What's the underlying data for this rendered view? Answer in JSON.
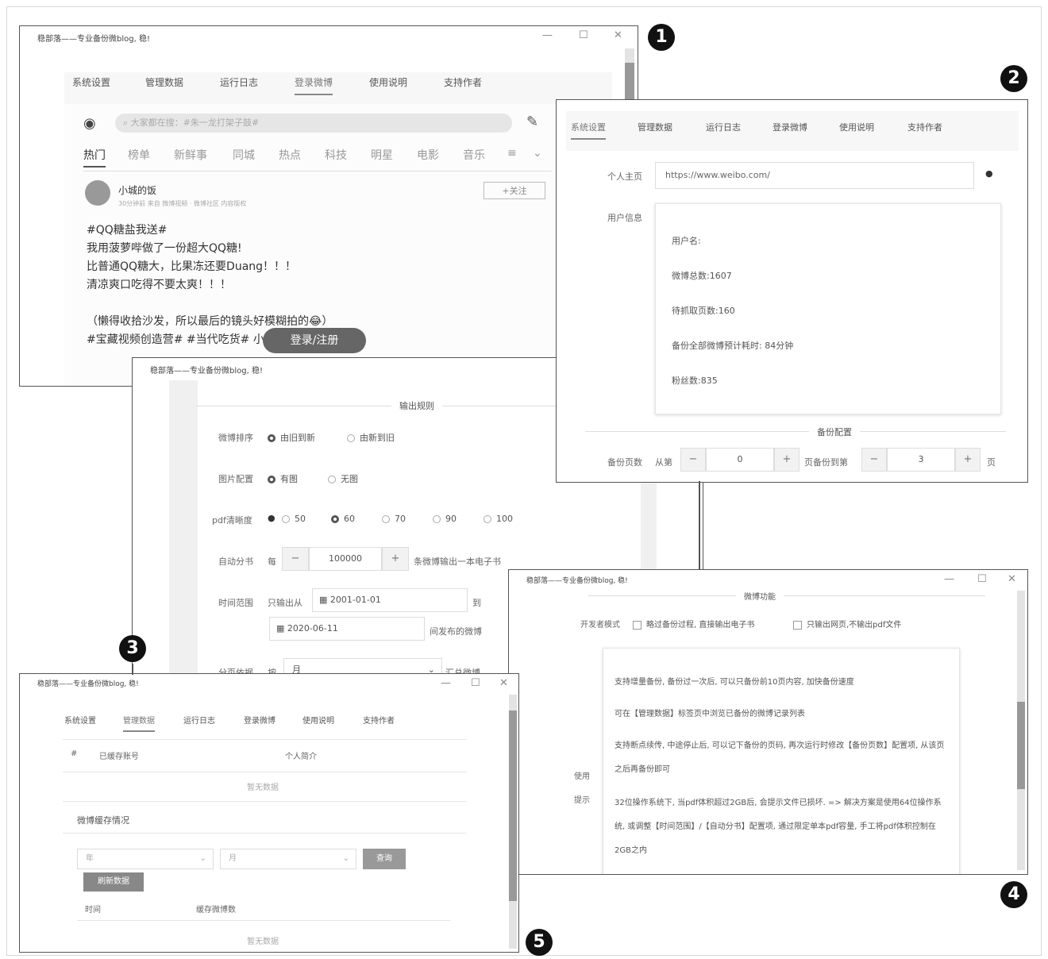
{
  "app_title": "稳部落——专业备份微blog, 稳!",
  "tabs": [
    "系统设置",
    "管理数据",
    "运行日志",
    "登录微博",
    "使用说明",
    "支持作者"
  ],
  "callouts": [
    "1",
    "2",
    "3",
    "4",
    "5"
  ],
  "win1": {
    "search_placeholder": "大家都在搜：#朱一龙打架子鼓#",
    "feed_tabs": [
      "热门",
      "榜单",
      "新鲜事",
      "同城",
      "热点",
      "科技",
      "明星",
      "电影",
      "音乐",
      "≡"
    ],
    "user_name": "小城的饭",
    "post_meta": "30分钟前 来自 微博视频 · 微博社区 内容版权",
    "follow_label": "+关注",
    "post_lines": [
      "#QQ糖盐我送#",
      "我用菠萝哔做了一份超大QQ糖!",
      "比普通QQ糖大，比果冻还要Duang！！！",
      "清凉爽口吃得不要太爽！！！",
      "",
      "（懒得收拾沙发，所以最后的镜头好模糊拍的😂）",
      "#宝藏视频创造营# #当代吃货# 小城的饭的微博视频"
    ],
    "login_button": "登录/注册"
  },
  "win2": {
    "home_label": "个人主页",
    "home_value": "https://www.weibo.com/",
    "userinfo_label": "用户信息",
    "userinfo": [
      "用户名:",
      "微博总数:1607",
      "待抓取页数:160",
      "备份全部微博预计耗时: 84分钟",
      "粉丝数:835"
    ],
    "backup_section": "备份配置",
    "pages_label": "备份页数",
    "from_label": "从第",
    "from_value": "0",
    "to_label": "页备份到第",
    "to_value": "3",
    "page_unit": "页"
  },
  "win3": {
    "section": "输出规则",
    "sort_label": "微博排序",
    "sort_options": [
      "由旧到新",
      "由新到旧"
    ],
    "image_label": "图片配置",
    "image_options": [
      "有图",
      "无图"
    ],
    "pdf_label": "pdf清晰度",
    "pdf_options": [
      "50",
      "60",
      "70",
      "90",
      "100"
    ],
    "split_label": "自动分书",
    "split_each": "每",
    "split_value": "100000",
    "split_suffix": "条微博输出一本电子书",
    "time_label": "时间范围",
    "time_prefix": "只输出从",
    "date_from": "2001-01-01",
    "time_to": "到",
    "date_to": "2020-06-11",
    "time_suffix": "间发布的微博",
    "group_label": "分页依据",
    "group_by": "按",
    "group_value": "月",
    "group_suffix": "汇总微博"
  },
  "win4": {
    "section": "微博功能",
    "dev_label": "开发者模式",
    "dev_opt1": "略过备份过程, 直接输出电子书",
    "dev_opt2": "只输出网页,不输出pdf文件",
    "tips_label": "使用提示",
    "tips": [
      "支持增量备份, 备份过一次后, 可以只备份前10页内容, 加快备份速度",
      "可在【管理数据】标签页中浏览已备份的微博记录列表",
      "支持断点续传, 中途停止后, 可以记下备份的页码, 再次运行时修改【备份页数】配置项, 从该页之后再备份即可",
      "32位操作系统下, 当pdf体积超过2GB后, 会提示文件已损坏. => 解决方案是使用64位操作系统, 或调整【时间范围】/【自动分书】配置项, 通过限定单本pdf容量, 手工将pdf体积控制在2GB之内"
    ]
  },
  "win5": {
    "col_index": "#",
    "col_account": "已缓存账号",
    "col_profile": "个人简介",
    "empty1": "暂无数据",
    "cache_title": "微博缓存情况",
    "select_year": "年",
    "select_month": "月",
    "query_button": "查询",
    "refresh_button": "刷新数据",
    "col_time": "时间",
    "col_count": "缓存微博数",
    "empty2": "暂无数据"
  }
}
